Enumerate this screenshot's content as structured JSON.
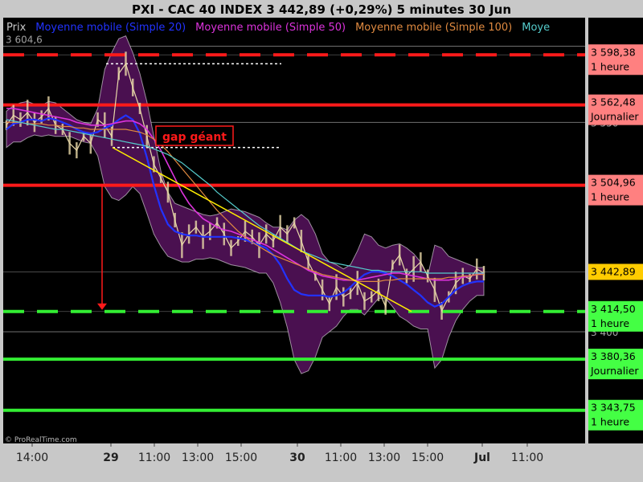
{
  "title": "PXI - CAC 40 INDEX     3 442,89 (+0,29%)     5 minutes  30 Jun",
  "legend": [
    {
      "text": "Prix",
      "color": "#c8c8c8"
    },
    {
      "text": "Moyenne mobile (Simple 20)",
      "color": "#2233ff"
    },
    {
      "text": "Moyenne mobile (Simple 50)",
      "color": "#dd33dd"
    },
    {
      "text": "Moyenne mobile (Simple 100)",
      "color": "#e08a40"
    },
    {
      "text": "Moye",
      "color": "#55cccc"
    }
  ],
  "annotation": "gap géant",
  "watermark": "© ProRealTime.com",
  "colors": {
    "background": "#000000",
    "candles": "#e8d8a8",
    "bollinger_fill": "#4a1050",
    "ma20": "#2233ff",
    "ma50": "#dd33dd",
    "ma100": "#e08a40",
    "ma200": "#55cccc",
    "trendline": "#ffee00",
    "resistance": "#ff1a1a",
    "support": "#33ee33"
  },
  "chart_data": {
    "type": "line",
    "ylim": [
      3320,
      3625
    ],
    "x_ticks": [
      {
        "label": "14:00",
        "bold": false
      },
      {
        "label": "29",
        "bold": true
      },
      {
        "label": "11:00",
        "bold": false
      },
      {
        "label": "13:00",
        "bold": false
      },
      {
        "label": "15:00",
        "bold": false
      },
      {
        "label": "30",
        "bold": true
      },
      {
        "label": "11:00",
        "bold": false
      },
      {
        "label": "13:00",
        "bold": false
      },
      {
        "label": "15:00",
        "bold": false
      },
      {
        "label": "Jul",
        "bold": true
      },
      {
        "label": "11:00",
        "bold": false
      }
    ],
    "y_ticks": [
      {
        "label": "3 604,6",
        "value": 3604.6,
        "side": "left"
      },
      {
        "label": "3 550",
        "value": 3550,
        "side": "right"
      },
      {
        "label": "3 400",
        "value": 3400,
        "side": "right"
      }
    ],
    "series": [
      {
        "name": "Prix",
        "key": "price",
        "values": [
          3548,
          3555,
          3552,
          3557,
          3550,
          3554,
          3560,
          3548,
          3545,
          3535,
          3530,
          3540,
          3535,
          3552,
          3548,
          3540,
          3585,
          3592,
          3575,
          3560,
          3540,
          3520,
          3510,
          3500,
          3480,
          3462,
          3470,
          3475,
          3468,
          3472,
          3478,
          3470,
          3460,
          3465,
          3472,
          3468,
          3462,
          3470,
          3465,
          3475,
          3470,
          3478,
          3465,
          3450,
          3440,
          3430,
          3420,
          3432,
          3425,
          3428,
          3435,
          3422,
          3425,
          3430,
          3418,
          3448,
          3455,
          3440,
          3445,
          3450,
          3440,
          3430,
          3415,
          3425,
          3435,
          3440,
          3438,
          3445,
          3442
        ]
      },
      {
        "name": "Moyenne mobile (Simple 20)",
        "key": "ma20",
        "values": [
          3545,
          3549,
          3550,
          3552,
          3552,
          3551,
          3553,
          3552,
          3550,
          3548,
          3545,
          3543,
          3542,
          3543,
          3546,
          3548,
          3552,
          3555,
          3552,
          3542,
          3525,
          3505,
          3488,
          3477,
          3472,
          3470,
          3469,
          3469,
          3468,
          3468,
          3468,
          3468,
          3468,
          3467,
          3466,
          3464,
          3462,
          3460,
          3455,
          3448,
          3438,
          3430,
          3427,
          3426,
          3426,
          3426,
          3425,
          3426,
          3428,
          3432,
          3437,
          3441,
          3443,
          3443,
          3442,
          3440,
          3437,
          3434,
          3430,
          3426,
          3421,
          3418,
          3420,
          3425,
          3430,
          3433,
          3435,
          3436,
          3436
        ]
      },
      {
        "name": "Moyenne mobile (Simple 50)",
        "key": "ma50",
        "values": [
          3560,
          3560,
          3559,
          3558,
          3557,
          3556,
          3555,
          3554,
          3553,
          3552,
          3550,
          3549,
          3548,
          3548,
          3548,
          3549,
          3550,
          3551,
          3551,
          3549,
          3545,
          3538,
          3530,
          3520,
          3510,
          3500,
          3492,
          3486,
          3481,
          3478,
          3475,
          3473,
          3472,
          3470,
          3468,
          3466,
          3464,
          3462,
          3459,
          3456,
          3453,
          3450,
          3447,
          3444,
          3442,
          3440,
          3439,
          3438,
          3437,
          3437,
          3437,
          3438,
          3439,
          3440,
          3441,
          3442,
          3442,
          3441,
          3440,
          3439,
          3438,
          3437,
          3437,
          3437,
          3438,
          3439,
          3440,
          3441,
          3442
        ]
      },
      {
        "name": "Moyenne mobile (Simple 100)",
        "key": "ma100",
        "values": [
          3550,
          3550,
          3550,
          3549,
          3549,
          3549,
          3548,
          3548,
          3547,
          3547,
          3546,
          3546,
          3545,
          3545,
          3545,
          3545,
          3545,
          3545,
          3544,
          3543,
          3541,
          3538,
          3534,
          3529,
          3523,
          3517,
          3511,
          3505,
          3499,
          3493,
          3487,
          3482,
          3477,
          3472,
          3468,
          3464,
          3461,
          3458,
          3455,
          3453,
          3451,
          3449,
          3447,
          3445,
          3443,
          3441,
          3440,
          3439,
          3438,
          3437,
          3436,
          3436,
          3436,
          3436,
          3437,
          3437,
          3438,
          3438,
          3438,
          3438,
          3438,
          3438,
          3438,
          3439,
          3439,
          3440,
          3440,
          3441,
          3441
        ]
      },
      {
        "name": "Moye",
        "key": "ma200",
        "values": [
          3552,
          3551,
          3550,
          3549,
          3548,
          3547,
          3546,
          3545,
          3545,
          3544,
          3543,
          3542,
          3541,
          3540,
          3539,
          3538,
          3537,
          3536,
          3535,
          3534,
          3533,
          3531,
          3529,
          3527,
          3524,
          3521,
          3517,
          3513,
          3509,
          3505,
          3500,
          3496,
          3492,
          3488,
          3484,
          3480,
          3476,
          3473,
          3470,
          3467,
          3464,
          3461,
          3458,
          3456,
          3454,
          3452,
          3450,
          3449,
          3448,
          3447,
          3446,
          3445,
          3444,
          3444,
          3443,
          3443,
          3443,
          3443,
          3443,
          3443,
          3442,
          3442,
          3442,
          3442,
          3442,
          3442,
          3442,
          3442,
          3442
        ]
      }
    ],
    "bollinger": {
      "upper": [
        3558,
        3562,
        3564,
        3565,
        3563,
        3562,
        3565,
        3564,
        3560,
        3556,
        3552,
        3550,
        3549,
        3560,
        3588,
        3600,
        3610,
        3612,
        3600,
        3585,
        3565,
        3540,
        3515,
        3500,
        3492,
        3490,
        3488,
        3486,
        3484,
        3483,
        3484,
        3486,
        3488,
        3487,
        3486,
        3484,
        3482,
        3478,
        3475,
        3475,
        3473,
        3480,
        3484,
        3480,
        3470,
        3456,
        3450,
        3448,
        3445,
        3448,
        3458,
        3470,
        3468,
        3462,
        3460,
        3462,
        3463,
        3460,
        3456,
        3450,
        3440,
        3462,
        3460,
        3454,
        3452,
        3450,
        3448,
        3446,
        3446
      ],
      "lower": [
        3532,
        3536,
        3536,
        3539,
        3541,
        3540,
        3541,
        3540,
        3540,
        3540,
        3538,
        3536,
        3535,
        3526,
        3504,
        3496,
        3494,
        3498,
        3504,
        3499,
        3485,
        3470,
        3461,
        3454,
        3452,
        3450,
        3450,
        3452,
        3452,
        3453,
        3452,
        3450,
        3448,
        3447,
        3446,
        3444,
        3442,
        3442,
        3435,
        3421,
        3403,
        3380,
        3370,
        3372,
        3382,
        3396,
        3400,
        3404,
        3411,
        3416,
        3416,
        3412,
        3418,
        3424,
        3424,
        3418,
        3411,
        3408,
        3404,
        3402,
        3402,
        3374,
        3380,
        3396,
        3408,
        3416,
        3422,
        3426,
        3426
      ]
    },
    "levels": [
      {
        "value": 3598.38,
        "label": "3 598,38",
        "sub": "1 heure",
        "kind": "resistance",
        "style": "dashed"
      },
      {
        "value": 3562.48,
        "label": "3 562,48",
        "sub": "Journalier",
        "kind": "resistance",
        "style": "solid"
      },
      {
        "value": 3504.96,
        "label": "3 504,96",
        "sub": "1 heure",
        "kind": "resistance",
        "style": "solid"
      },
      {
        "value": 3442.89,
        "label": "3 442,89",
        "sub": "",
        "kind": "price",
        "style": "none"
      },
      {
        "value": 3414.5,
        "label": "3 414,50",
        "sub": "1 heure",
        "kind": "support",
        "style": "dashed"
      },
      {
        "value": 3380.36,
        "label": "3 380,36",
        "sub": "Journalier",
        "kind": "support",
        "style": "solid"
      },
      {
        "value": 3343.75,
        "label": "3 343,75",
        "sub": "1 heure",
        "kind": "support",
        "style": "solid"
      }
    ]
  }
}
